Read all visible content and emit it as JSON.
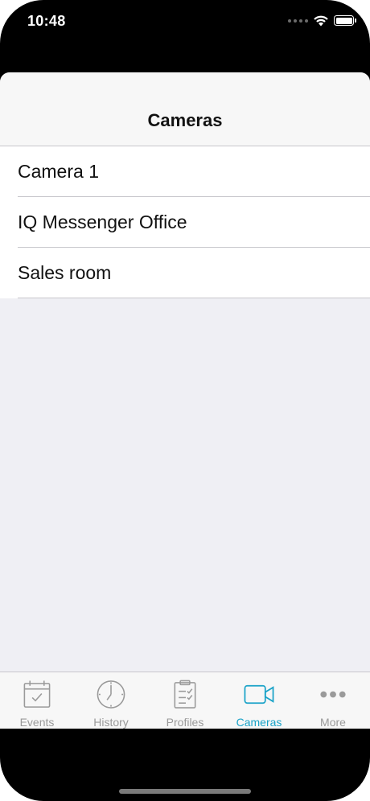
{
  "status_bar": {
    "time": "10:48",
    "icons": [
      "signal-dots-icon",
      "wifi-icon",
      "battery-icon"
    ]
  },
  "nav": {
    "title": "Cameras"
  },
  "cameras": [
    {
      "label": "Camera 1"
    },
    {
      "label": "IQ Messenger Office"
    },
    {
      "label": "Sales room"
    }
  ],
  "tab_bar": {
    "tabs": [
      {
        "label": "Events",
        "icon": "calendar-icon",
        "active": false
      },
      {
        "label": "History",
        "icon": "clock-icon",
        "active": false
      },
      {
        "label": "Profiles",
        "icon": "clipboard-icon",
        "active": false
      },
      {
        "label": "Cameras",
        "icon": "video-camera-icon",
        "active": true
      },
      {
        "label": "More",
        "icon": "more-dots-icon",
        "active": false
      }
    ]
  },
  "colors": {
    "accent": "#1aa3c8",
    "inactive": "#9a9a9a",
    "background": "#efeff4"
  }
}
